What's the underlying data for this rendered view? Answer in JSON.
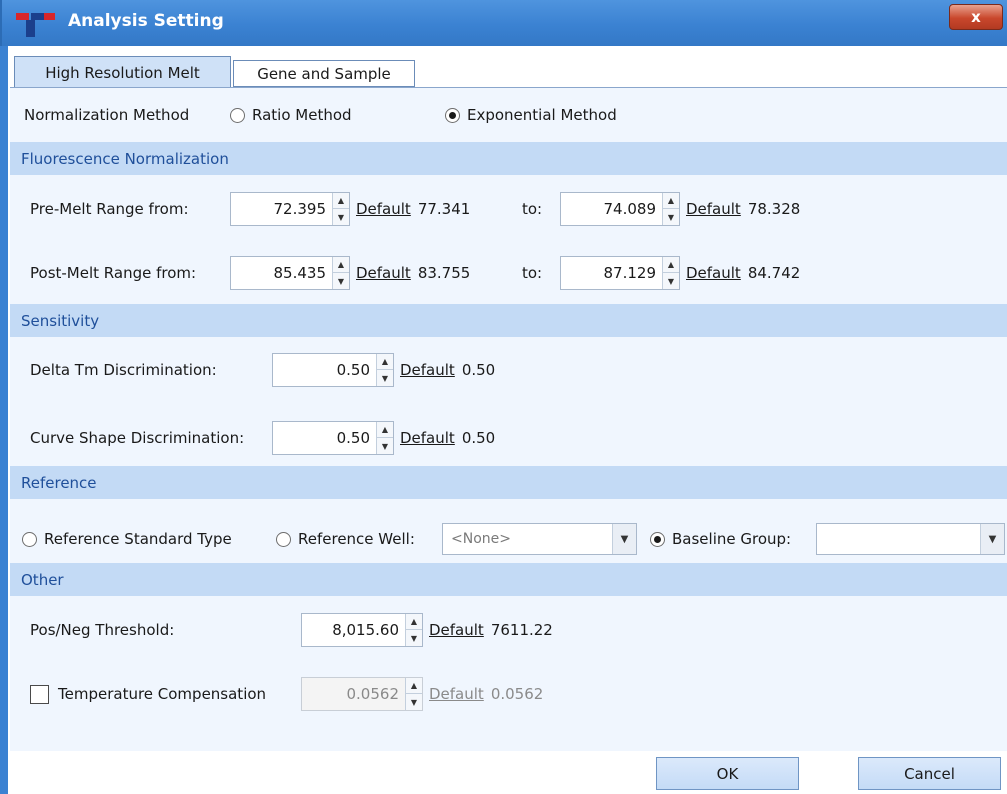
{
  "window": {
    "title": "Analysis Setting",
    "close_glyph": "x"
  },
  "tabs": [
    {
      "label": "High Resolution Melt",
      "active": true
    },
    {
      "label": "Gene and Sample",
      "active": false
    }
  ],
  "normalization": {
    "label": "Normalization Method",
    "options": [
      {
        "label": "Ratio Method",
        "checked": false
      },
      {
        "label": "Exponential Method",
        "checked": true
      }
    ]
  },
  "sections": {
    "fluorescence": "Fluorescence Normalization",
    "sensitivity": "Sensitivity",
    "reference": "Reference",
    "other": "Other"
  },
  "fluorescence": {
    "pre_melt": {
      "label": "Pre-Melt Range from:",
      "from": "72.395",
      "from_default": "77.341",
      "to_label": "to:",
      "to": "74.089",
      "to_default": "78.328"
    },
    "post_melt": {
      "label": "Post-Melt Range from:",
      "from": "85.435",
      "from_default": "83.755",
      "to_label": "to:",
      "to": "87.129",
      "to_default": "84.742"
    }
  },
  "sensitivity": {
    "delta_tm": {
      "label": "Delta Tm Discrimination:",
      "value": "0.50",
      "default": "0.50"
    },
    "curve_shape": {
      "label": "Curve Shape Discrimination:",
      "value": "0.50",
      "default": "0.50"
    }
  },
  "reference": {
    "standard_type": {
      "label": "Reference Standard Type",
      "checked": false
    },
    "well": {
      "label": "Reference Well:",
      "checked": false,
      "value": "<None>"
    },
    "baseline": {
      "label": "Baseline Group:",
      "checked": true,
      "value": ""
    }
  },
  "other": {
    "threshold": {
      "label": "Pos/Neg Threshold:",
      "value": "8,015.60",
      "default": "7611.22"
    },
    "temp_comp": {
      "label": "Temperature Compensation",
      "checked": false,
      "value": "0.0562",
      "default": "0.0562"
    }
  },
  "common": {
    "default_link": "Default"
  },
  "buttons": {
    "ok": "OK",
    "cancel": "Cancel"
  },
  "icons": {
    "app_logo": "t-logo-icon",
    "spin_up": "chevron-up-icon",
    "spin_down": "chevron-down-icon",
    "dropdown": "dropdown-arrow-icon"
  },
  "colors": {
    "titlebar": "#3b82d2",
    "section_header": "#c3daf5",
    "panel": "#f0f6fe",
    "close_button": "#c9472c"
  }
}
